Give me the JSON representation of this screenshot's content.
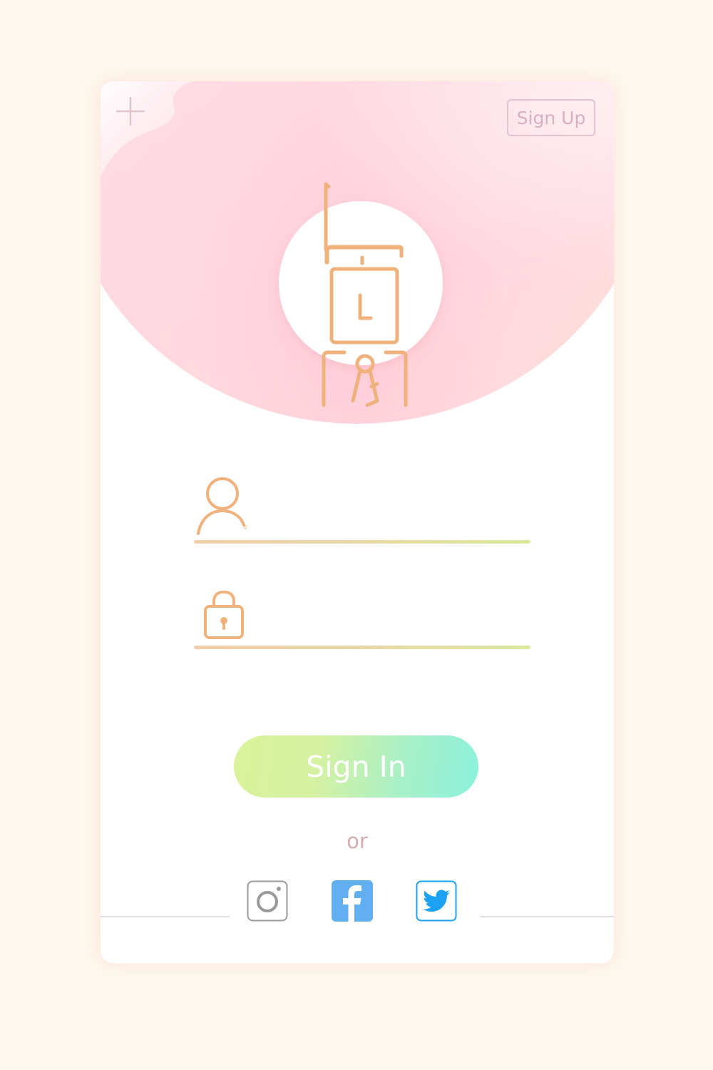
{
  "header": {
    "signup_label": "Sign Up"
  },
  "logo": {
    "letter": "L"
  },
  "form": {
    "username_placeholder": "",
    "password_placeholder": ""
  },
  "actions": {
    "signin_label": "Sign In",
    "or_label": "or"
  },
  "social": [
    {
      "name": "instagram-icon"
    },
    {
      "name": "facebook-icon"
    },
    {
      "name": "twitter-icon"
    }
  ],
  "colors": {
    "background": "#fdf8ee",
    "accent_orange": "#efb27c",
    "signup_border": "#e3c4cf",
    "signin_gradient_start": "#daf29a",
    "signin_gradient_end": "#8cf1dc",
    "facebook_blue": "#61aef1",
    "twitter_blue": "#1da1f2"
  }
}
